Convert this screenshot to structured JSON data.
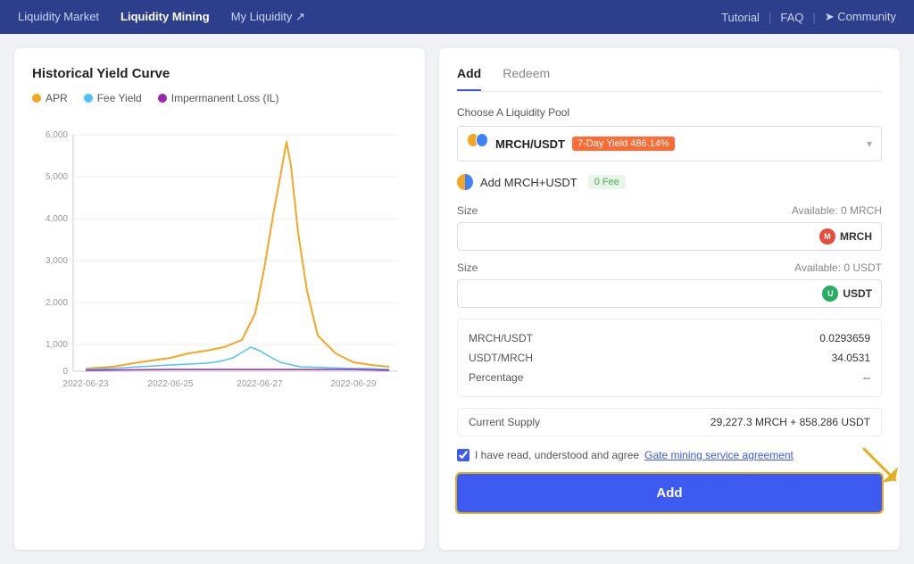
{
  "nav": {
    "items": [
      {
        "label": "Liquidity Market",
        "active": false
      },
      {
        "label": "Liquidity Mining",
        "active": true
      },
      {
        "label": "My Liquidity ↗",
        "active": false
      }
    ],
    "right": {
      "tutorial": "Tutorial",
      "faq": "FAQ",
      "community": "➤ Community"
    }
  },
  "left": {
    "chart_title": "Historical Yield Curve",
    "legend": [
      {
        "label": "APR",
        "color": "#f5a623"
      },
      {
        "label": "Fee Yield",
        "color": "#4fc3f7"
      },
      {
        "label": "Impermanent Loss (IL)",
        "color": "#9c27b0"
      }
    ],
    "y_labels": [
      "6,000",
      "5,000",
      "4,000",
      "3,000",
      "2,000",
      "1,000",
      "0"
    ],
    "x_labels": [
      "2022-06-23",
      "2022-06-25",
      "2022-06-27",
      "2022-06-29"
    ]
  },
  "right": {
    "tabs": [
      {
        "label": "Add",
        "active": true
      },
      {
        "label": "Redeem",
        "active": false
      }
    ],
    "pool_label": "Choose A Liquidity Pool",
    "pool_name": "MRCH/USDT",
    "yield_badge": "7-Day Yield 486.14%",
    "add_token_label": "Add MRCH+USDT",
    "fee_badge": "0 Fee",
    "size1_label": "Size",
    "available1": "Available: 0 MRCH",
    "token1": "MRCH",
    "size2_label": "Size",
    "available2": "Available: 0 USDT",
    "token2": "USDT",
    "rates": [
      {
        "label": "MRCH/USDT",
        "value": "0.0293659"
      },
      {
        "label": "USDT/MRCH",
        "value": "34.0531"
      },
      {
        "label": "Percentage",
        "value": "--"
      }
    ],
    "supply_label": "Current Supply",
    "supply_value": "29,227.3 MRCH + 858.286 USDT",
    "agree_text": "I have read, understood and agree",
    "agree_link": "Gate mining service agreement",
    "add_button": "Add"
  }
}
